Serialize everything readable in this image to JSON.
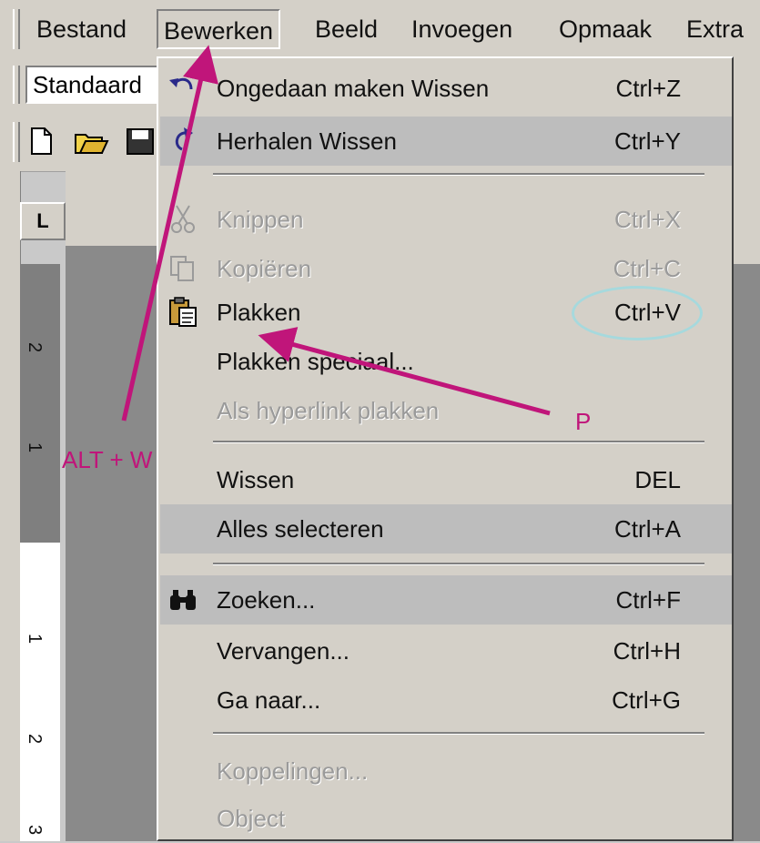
{
  "menubar": {
    "items": [
      {
        "label": "Bestand"
      },
      {
        "label": "Bewerken"
      },
      {
        "label": "Beeld"
      },
      {
        "label": "Invoegen"
      },
      {
        "label": "Opmaak"
      },
      {
        "label": "Extra"
      }
    ]
  },
  "toolbar": {
    "style_value": "Standaard"
  },
  "ruler": {
    "corner": "L",
    "numbers": [
      "2",
      "1",
      "1",
      "2",
      "3"
    ]
  },
  "edit_menu": {
    "items": [
      {
        "icon": "undo-icon",
        "label": "Ongedaan maken Wissen",
        "shortcut": "Ctrl+Z",
        "enabled": true
      },
      {
        "icon": "redo-icon",
        "label": "Herhalen Wissen",
        "shortcut": "Ctrl+Y",
        "enabled": true
      },
      {
        "icon": "scissors-icon",
        "label": "Knippen",
        "shortcut": "Ctrl+X",
        "enabled": false
      },
      {
        "icon": "copy-icon",
        "label": "Kopiëren",
        "shortcut": "Ctrl+C",
        "enabled": false
      },
      {
        "icon": "paste-icon",
        "label": "Plakken",
        "shortcut": "Ctrl+V",
        "enabled": true
      },
      {
        "icon": "",
        "label": "Plakken speciaal...",
        "shortcut": "",
        "enabled": true
      },
      {
        "icon": "",
        "label": "Als hyperlink plakken",
        "shortcut": "",
        "enabled": false
      },
      {
        "icon": "",
        "label": "Wissen",
        "shortcut": "DEL",
        "enabled": true
      },
      {
        "icon": "",
        "label": "Alles selecteren",
        "shortcut": "Ctrl+A",
        "enabled": true
      },
      {
        "icon": "binoculars-icon",
        "label": "Zoeken...",
        "shortcut": "Ctrl+F",
        "enabled": true
      },
      {
        "icon": "",
        "label": "Vervangen...",
        "shortcut": "Ctrl+H",
        "enabled": true
      },
      {
        "icon": "",
        "label": "Ga naar...",
        "shortcut": "Ctrl+G",
        "enabled": true
      },
      {
        "icon": "",
        "label": "Koppelingen...",
        "shortcut": "",
        "enabled": false
      },
      {
        "icon": "",
        "label": "Object",
        "shortcut": "",
        "enabled": false
      }
    ]
  },
  "annotations": {
    "alt_w": "ALT + W",
    "p": "P"
  },
  "colors": {
    "arrow": "#c0157a",
    "circle": "#a6d9dd"
  }
}
